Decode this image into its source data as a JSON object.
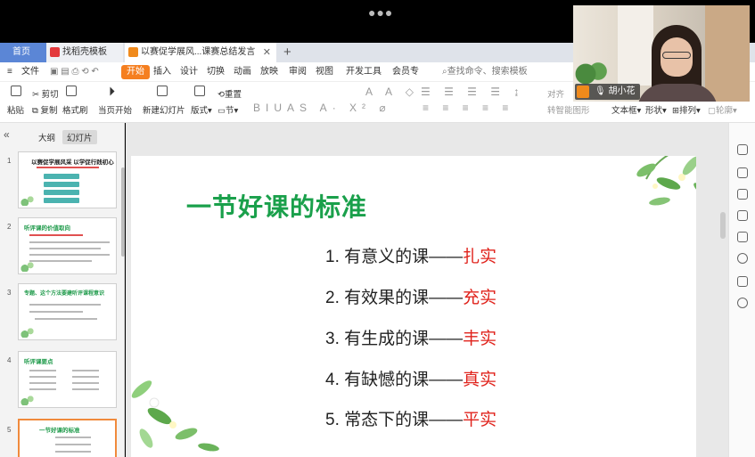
{
  "window": {
    "tabs": [
      {
        "label": "首页"
      },
      {
        "label": "找稻壳模板"
      },
      {
        "label": "以赛促学展风...课赛总结发言"
      }
    ]
  },
  "menu": {
    "file": "文件",
    "items": [
      "开始",
      "插入",
      "设计",
      "切换",
      "动画",
      "放映",
      "审阅",
      "视图",
      "开发工具",
      "会员专"
    ],
    "search": "查找命令、搜索模板"
  },
  "ribbon": {
    "paste": "粘贴",
    "cut": "剪切",
    "copy": "复制",
    "format_painter": "格式刷",
    "play": "当页开始",
    "new_slide": "新建幻灯片",
    "layout": "版式",
    "section": "节",
    "reset": "重置",
    "convert": "转智能图形",
    "textbox": "文本框",
    "shape": "形状",
    "arrange": "排列",
    "outline": "轮廓",
    "align_right_hint": "对齐"
  },
  "sidebar": {
    "tabs": [
      "大纲",
      "幻灯片"
    ],
    "slides": [
      {
        "num": "1",
        "title": "以赛促学展风采  以学促行践初心"
      },
      {
        "num": "2",
        "title": "听评课的价值取向"
      },
      {
        "num": "3",
        "title": "专题、这个方法要建听评课程意识"
      },
      {
        "num": "4",
        "title": "听评课要点"
      },
      {
        "num": "5",
        "title": "一节好课的标准"
      }
    ]
  },
  "slide": {
    "title": "一节好课的标准",
    "items": [
      {
        "prefix": "1. 有意义的课——",
        "highlight": "扎实"
      },
      {
        "prefix": "2. 有效果的课——",
        "highlight": "充实"
      },
      {
        "prefix": "3. 有生成的课——",
        "highlight": "丰实"
      },
      {
        "prefix": "4. 有缺憾的课——",
        "highlight": "真实"
      },
      {
        "prefix": "5. 常态下的课——",
        "highlight": "平实"
      }
    ]
  },
  "video": {
    "name": "胡小花"
  },
  "colors": {
    "accent": "#f57f20",
    "title_green": "#1aa04b",
    "highlight_red": "#e0231c"
  }
}
